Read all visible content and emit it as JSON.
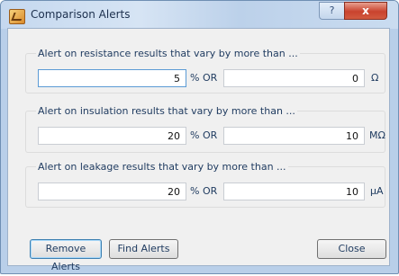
{
  "window": {
    "title": "Comparison Alerts",
    "help_glyph": "?",
    "close_glyph": "x"
  },
  "groups": [
    {
      "label": "Alert on resistance results that vary by more than ...",
      "percent_value": "5",
      "percent_label": "% OR",
      "absolute_value": "0",
      "unit": "Ω"
    },
    {
      "label": "Alert on insulation results that vary by more than ...",
      "percent_value": "20",
      "percent_label": "% OR",
      "absolute_value": "10",
      "unit": "MΩ"
    },
    {
      "label": "Alert on leakage results that vary by more than ...",
      "percent_value": "20",
      "percent_label": "% OR",
      "absolute_value": "10",
      "unit": "µA"
    }
  ],
  "buttons": {
    "remove_alerts": "Remove Alerts",
    "find_alerts": "Find Alerts",
    "close": "Close"
  }
}
